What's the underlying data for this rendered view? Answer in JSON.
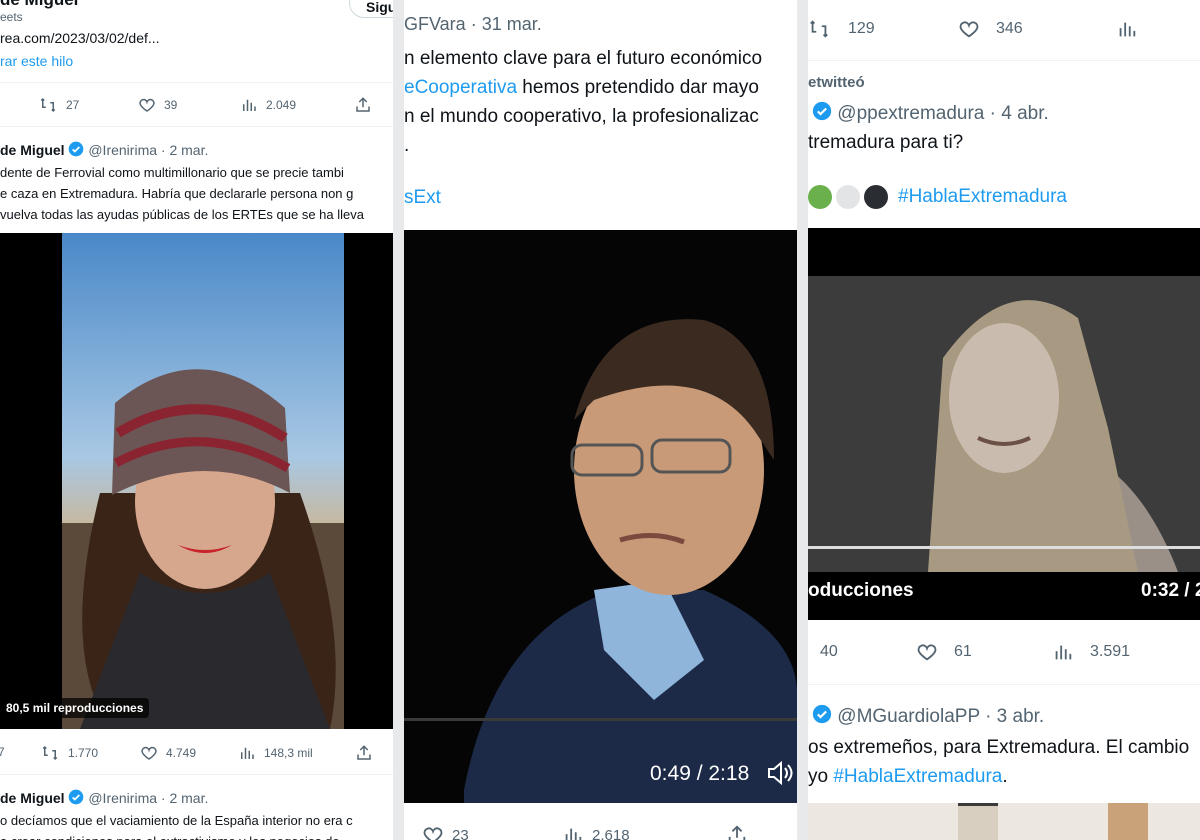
{
  "col1": {
    "top": {
      "name_partial": "de Miguel",
      "retweets_partial": "eets",
      "link_partial": "rea.com/2023/03/02/def...",
      "show_thread": "rar este hilo",
      "follow_partial": "Sigu",
      "actions": {
        "retweets": "27",
        "likes": "39",
        "views": "2.049"
      }
    },
    "tweet2": {
      "name": "de Miguel",
      "handle": "@Irenirima",
      "date": "· 2 mar.",
      "lines": [
        "dente de Ferrovial como multimillonario que se precie tambi",
        "e caza en Extremadura. Habría que declararle persona non g",
        "vuelva todas las ayudas públicas de los ERTEs que se ha lleva"
      ],
      "views_badge": "80,5 mil reproducciones",
      "actions": {
        "replies": "7",
        "retweets": "1.770",
        "likes": "4.749",
        "views": "148,3 mil"
      }
    },
    "tweet3": {
      "name": "de Miguel",
      "handle": "@Irenirima",
      "date": "· 2 mar.",
      "lines": [
        "o decíamos que el vaciamiento de la España interior no era c",
        "a crear condiciones para el extractivismo y los negocios de"
      ]
    }
  },
  "col2": {
    "header": {
      "handle_partial": "GFVara",
      "date": "· 31 mar."
    },
    "lines": [
      {
        "pre": "n elemento clave para el futuro económico",
        "link": "",
        "post": ""
      },
      {
        "pre": "",
        "link": "eCooperativa",
        "post": " hemos pretendido dar mayo"
      },
      {
        "pre": "n el mundo cooperativo, la profesionalizac",
        "link": "",
        "post": ""
      },
      {
        "pre": ".",
        "link": "",
        "post": ""
      }
    ],
    "hashtag_partial": "sExt",
    "time": "0:49 / 2:18",
    "actions": {
      "replies": "23",
      "views": "2.618"
    }
  },
  "col3": {
    "top_actions": {
      "retweets": "129",
      "likes": "346"
    },
    "retweeted": "etwitteó",
    "tweet1": {
      "handle": "@ppextremadura",
      "date": "· 4 abr.",
      "text": "tremadura para ti?",
      "hashtag": "#HablaExtremadura",
      "dot_colors": [
        "#6ab04c",
        "#e2e4e6",
        "#2a2d31"
      ],
      "views_label": "oducciones",
      "time": "0:32 / 2",
      "actions": {
        "retweets": "40",
        "likes": "61",
        "views": "3.591"
      }
    },
    "tweet2": {
      "handle": "@MGuardiolaPP",
      "date": "· 3 abr.",
      "line1": "os extremeños, para Extremadura. El cambio",
      "line2_pre": "yo ",
      "line2_link": "#HablaExtremadura",
      "line2_post": "."
    }
  },
  "colors": {
    "accent": "#1d9bf0",
    "muted": "#536471",
    "text": "#0f1419"
  }
}
